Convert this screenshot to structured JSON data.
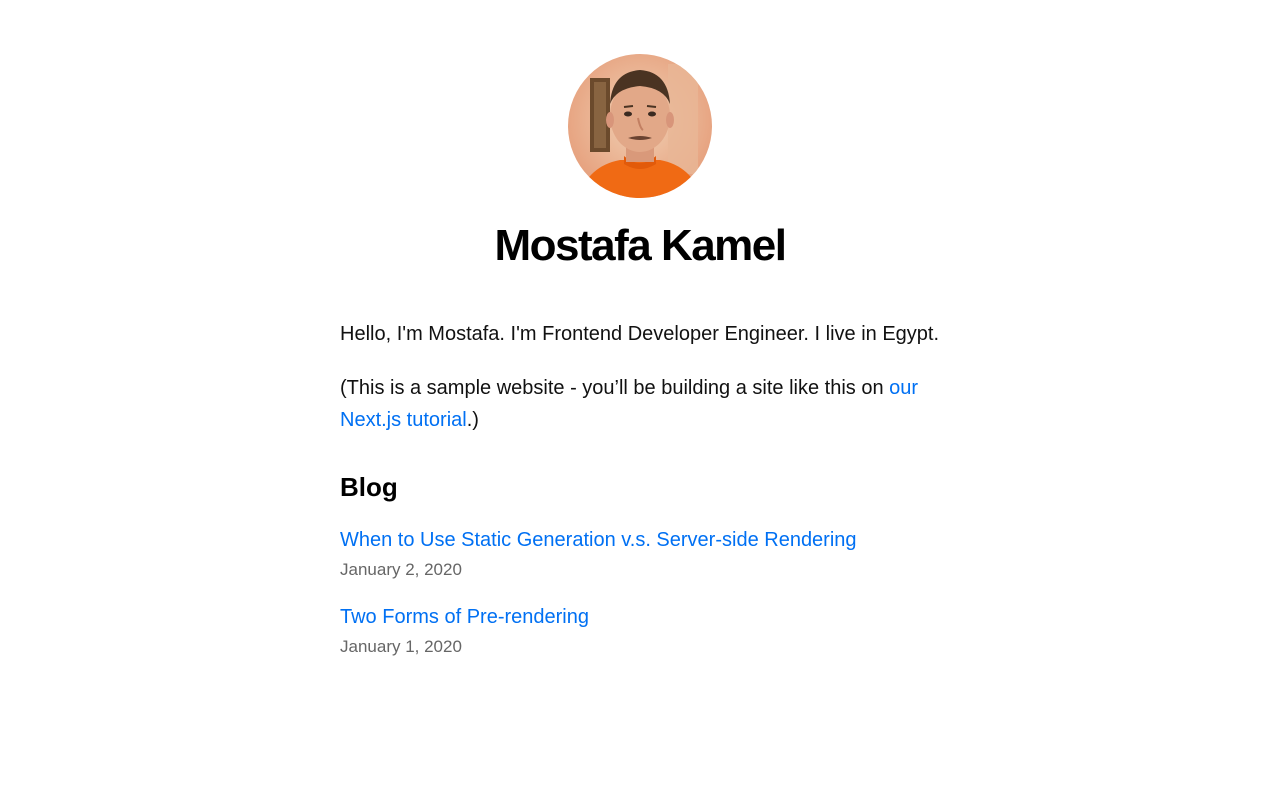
{
  "profile": {
    "name": "Mostafa Kamel",
    "avatar_icon": "profile-photo"
  },
  "intro": {
    "bio": "Hello, I'm Mostafa. I'm Frontend Developer Engineer. I live in Egypt.",
    "sample_prefix": "(This is a sample website - you’ll be building a site like this on ",
    "tutorial_link": "our Next.js tutorial",
    "sample_suffix": ".)"
  },
  "blog": {
    "heading": "Blog",
    "posts": [
      {
        "title": "When to Use Static Generation v.s. Server-side Rendering",
        "date": "January 2, 2020"
      },
      {
        "title": "Two Forms of Pre-rendering",
        "date": "January 1, 2020"
      }
    ]
  },
  "colors": {
    "link": "#0070f3",
    "date": "#666666",
    "text": "#111111"
  }
}
